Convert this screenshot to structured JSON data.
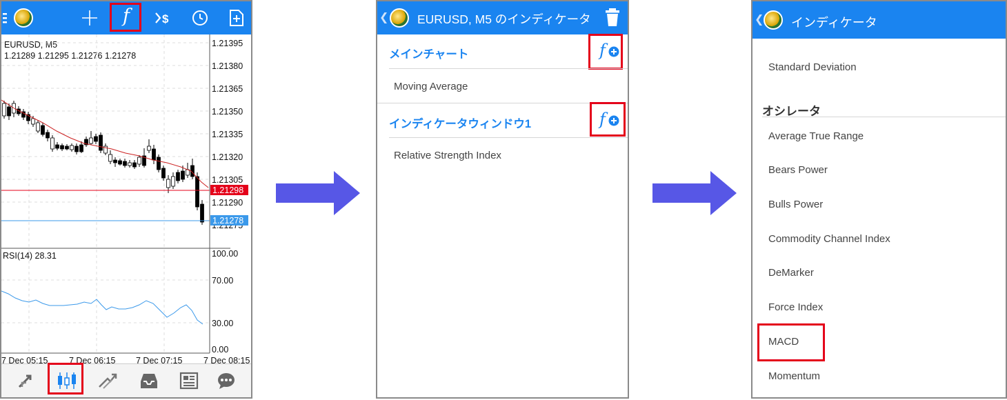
{
  "panel1": {
    "toolbar": {
      "func_glyph": "f"
    },
    "chart": {
      "symbol": "EURUSD, M5",
      "ohlc": "1.21289 1.21295 1.21276 1.21278",
      "price_ticks": [
        "1.21395",
        "1.21380",
        "1.21365",
        "1.21350",
        "1.21335",
        "1.21320",
        "1.21305",
        "1.21290",
        "1.21275"
      ],
      "bid_label": "1.21298",
      "ask_label": "1.21278",
      "rsi_label": "RSI(14) 28.31",
      "rsi_ticks": [
        "100.00",
        "70.00",
        "30.00",
        "0.00"
      ],
      "time_labels": [
        "7 Dec 05:15",
        "7 Dec 06:15",
        "7 Dec 07:15",
        "7 Dec 08:15"
      ],
      "colors": {
        "ma": "#cc2222",
        "bid": "#e4001a",
        "ask": "#3b99ea",
        "rsi": "#3b99ea"
      }
    }
  },
  "panel2": {
    "title": "EURUSD, M5 のインディケータ",
    "section_main": "メインチャート",
    "item_ma": "Moving Average",
    "section_window": "インディケータウィンドウ1",
    "item_rsi": "Relative Strength Index",
    "add_glyph": "f"
  },
  "panel3": {
    "title": "インディケータ",
    "item_std": "Standard Deviation",
    "section_osc": "オシレータ",
    "items": [
      "Average True Range",
      "Bears Power",
      "Bulls Power",
      "Commodity Channel Index",
      "DeMarker",
      "Force Index",
      "MACD",
      "Momentum"
    ]
  },
  "colors": {
    "accent": "#1a84f0",
    "highlight": "#e4001a",
    "arrow": "#5757e6"
  }
}
